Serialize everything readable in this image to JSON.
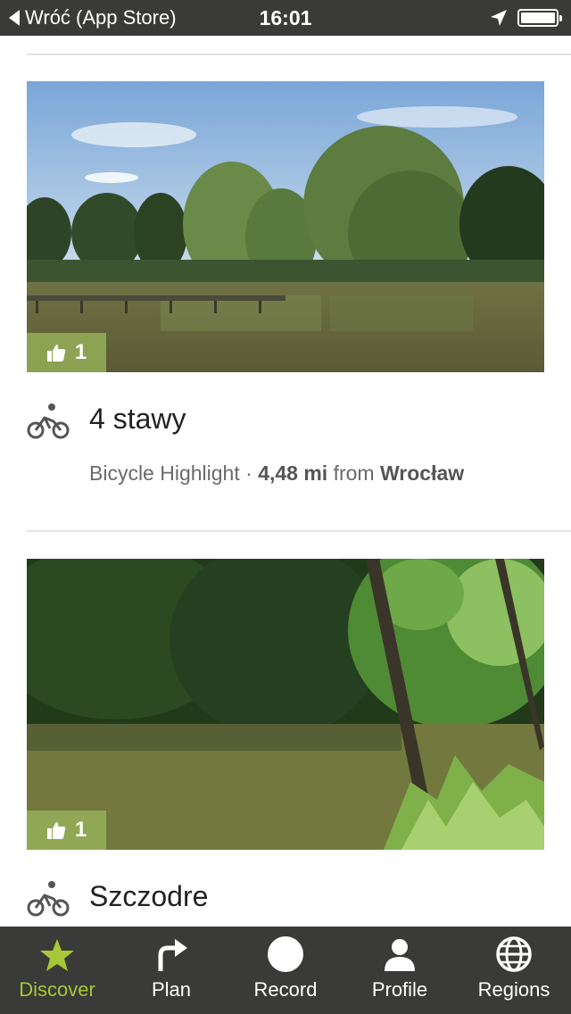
{
  "status_bar": {
    "back_label": "Wróć (App Store)",
    "time": "16:01",
    "location_icon": "location-arrow-icon",
    "battery_icon": "battery-icon"
  },
  "feed": {
    "cards": [
      {
        "title": "4 stawy",
        "likes": "1",
        "sport_icon": "bicycle-icon",
        "type": "Bicycle Highlight",
        "separator": "·",
        "distance": "4,48 mi",
        "from_word": "from",
        "place": "Wrocław"
      },
      {
        "title": "Szczodre",
        "likes": "1",
        "sport_icon": "bicycle-icon"
      }
    ]
  },
  "tab_bar": {
    "tabs": [
      {
        "label": "Discover",
        "icon": "star-icon",
        "active": true
      },
      {
        "label": "Plan",
        "icon": "turn-arrow-icon",
        "active": false
      },
      {
        "label": "Record",
        "icon": "record-circle-icon",
        "active": false
      },
      {
        "label": "Profile",
        "icon": "user-icon",
        "active": false
      },
      {
        "label": "Regions",
        "icon": "globe-icon",
        "active": false
      }
    ],
    "active_color": "#a6c836"
  }
}
